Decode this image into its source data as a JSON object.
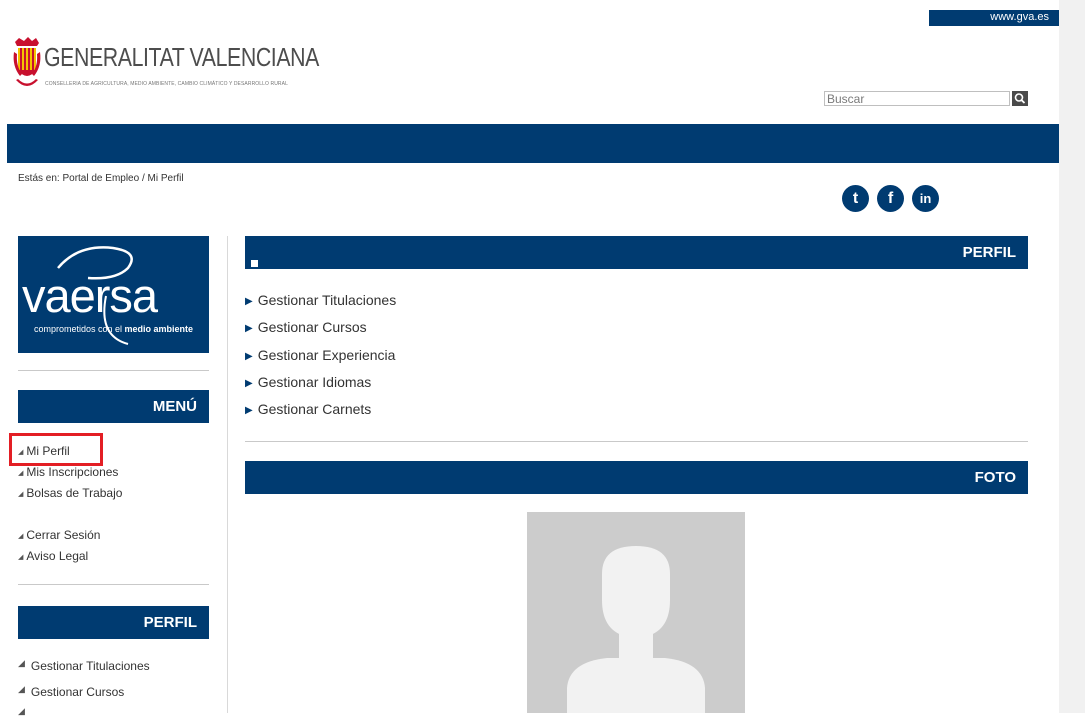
{
  "top_link": "www.gva.es",
  "logo": {
    "title": "GENERALITAT VALENCIANA",
    "subtitle": "CONSELLERIA DE AGRICULTURA, MEDIO AMBIENTE, CAMBIO CLIMÁTICO Y DESARROLLO RURAL"
  },
  "search": {
    "placeholder": "Buscar",
    "button_icon": "search-icon"
  },
  "breadcrumb": "Estás en: Portal de Empleo / Mi Perfil",
  "social": [
    {
      "icon": "twitter-icon",
      "glyph": "t"
    },
    {
      "icon": "facebook-icon",
      "glyph": "f"
    },
    {
      "icon": "linkedin-icon",
      "glyph": "in"
    }
  ],
  "vaersa": {
    "word": "vaersa",
    "tagline_prefix": "comprometidos con el ",
    "tagline_bold": "medio ambiente"
  },
  "menu": {
    "title": "MENÚ",
    "items": [
      "Mi Perfil",
      "Mis Inscripciones",
      "Bolsas de Trabajo"
    ],
    "items2": [
      "Cerrar Sesión",
      "Aviso Legal"
    ]
  },
  "side_perfil": {
    "title": "PERFIL",
    "items": [
      "Gestionar Titulaciones",
      "Gestionar Cursos"
    ]
  },
  "perfil": {
    "title": "PERFIL",
    "items": [
      "Gestionar Titulaciones",
      "Gestionar Cursos",
      "Gestionar Experiencia",
      "Gestionar Idiomas",
      "Gestionar Carnets"
    ]
  },
  "foto": {
    "title": "FOTO"
  },
  "colors": {
    "brand_blue": "#003b71",
    "highlight_red": "#e31e24",
    "photo_gray": "#cccccc"
  }
}
